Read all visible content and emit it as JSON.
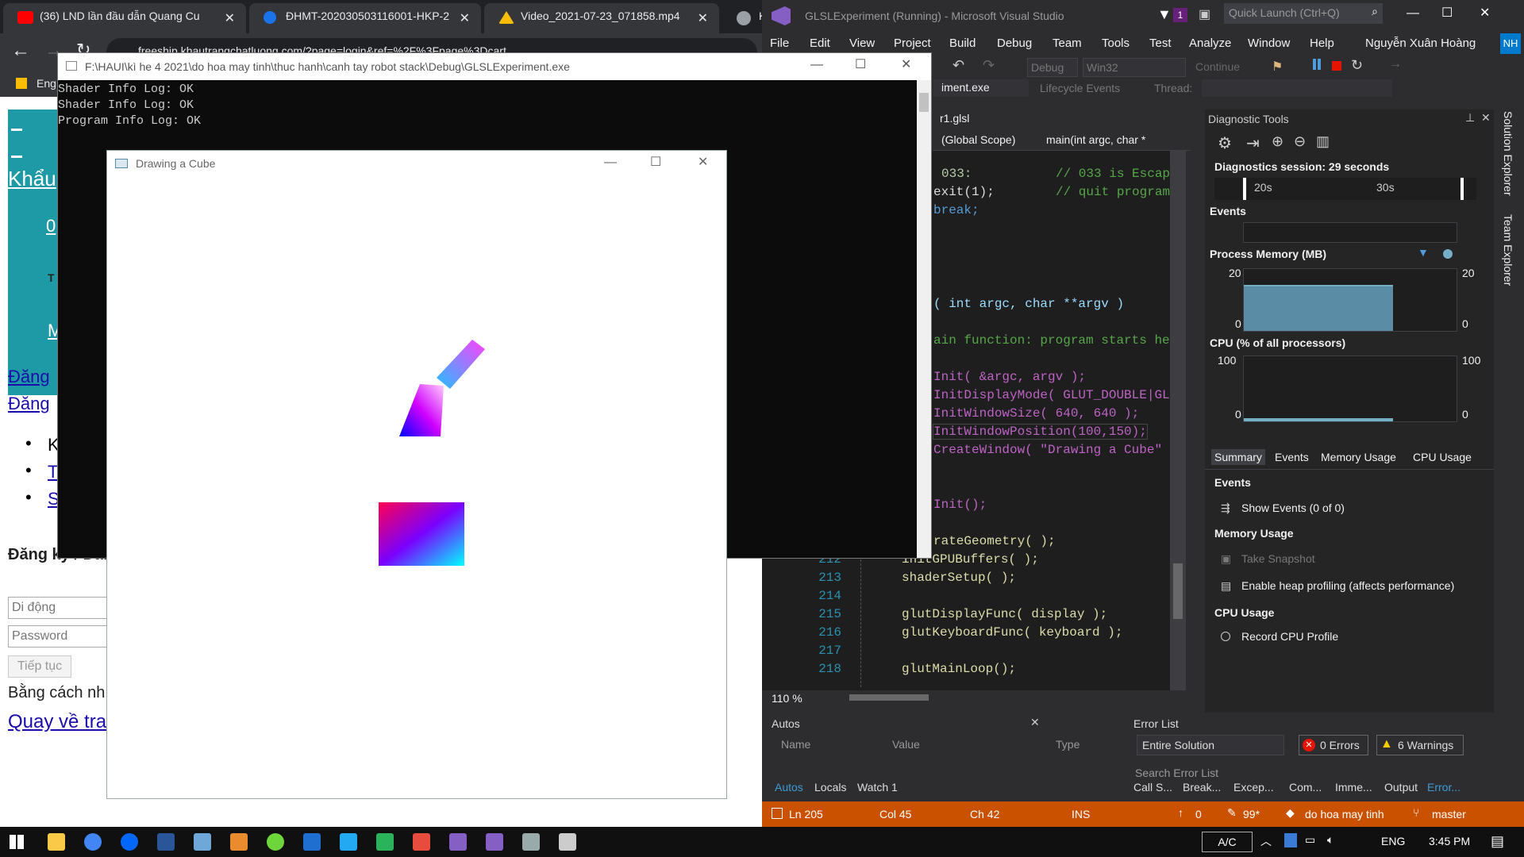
{
  "browser": {
    "tabs": [
      {
        "label": "(36) LND lần đầu dẫn Quang Cu",
        "icon": "youtube-icon",
        "color": "#ff0000"
      },
      {
        "label": "ĐHMT-20203050311600​1-HKP-2",
        "icon": "classroom-icon",
        "color": "#1a73e8"
      },
      {
        "label": "Video_2021-07-23_071858.mp4",
        "icon": "drive-icon",
        "color": "#fbbc04"
      },
      {
        "label": "K",
        "icon": "globe-icon",
        "color": "#9aa0a6"
      }
    ],
    "url": "freeship.khautrangchatluong.com/?page=login&ref=%2F%3Fpage%3Dcart",
    "bookmark": "Eng"
  },
  "webpage": {
    "heading_partial": "Khẩu",
    "list_link_1": "0",
    "small_t": "T",
    "link_m": "M",
    "link_dang1": "Đăng",
    "link_dang2": "Đăng",
    "bullets": [
      "K",
      "T",
      "S"
    ],
    "section_title": "Đăng ký / Đăng",
    "phone_placeholder": "Di động",
    "password_placeholder": "Password",
    "continue_button": "Tiếp tục",
    "bang_cach": "Bằng cách nh",
    "quay_ve": "Quay về tra"
  },
  "console": {
    "title": "F:\\HAUI\\kì he 4 2021\\do hoa may tinh\\thuc hanh\\canh tay robot stack\\Debug\\GLSLExperiment.exe",
    "lines": [
      "Shader Info Log: OK",
      "Shader Info Log: OK",
      "Program Info Log: OK"
    ]
  },
  "cube_window": {
    "title": "Drawing a Cube"
  },
  "vs": {
    "title": "GLSLExperiment (Running) - Microsoft Visual Studio",
    "notification_count": "1",
    "quick_launch": "Quick Launch (Ctrl+Q)",
    "menu": [
      "File",
      "Edit",
      "View",
      "Project",
      "Build",
      "Debug",
      "Team",
      "Tools",
      "Test",
      "Analyze",
      "Window",
      "Help"
    ],
    "user": "Nguyễn Xuân Hoàng",
    "user_initials": "NH",
    "toolbar": {
      "config": "Debug",
      "platform": "Win32",
      "continue": "Continue",
      "process": "iment.exe",
      "lifecycle": "Lifecycle Events",
      "thread": "Thread:"
    },
    "file_tab": "r1.glsl",
    "scope": "(Global Scope)",
    "function": "main(int argc, char *",
    "zoom": "110 %",
    "line_numbers": [
      "212",
      "213",
      "214",
      "215",
      "216",
      "217",
      "218"
    ],
    "code": {
      "l1a": "033:",
      "l1b": "// 033 is Escape",
      "l2a": "exit(1);",
      "l2b": "// quit program",
      "l3": "break;",
      "l4": "( int argc, char **argv )",
      "l5": "ain function: program starts her",
      "l6": "Init( &argc, argv );",
      "l7": "InitDisplayMode( GLUT_DOUBLE|GLU",
      "l8": "InitWindowSize( 640, 640 );",
      "l9": "InitWindowPosition(100,150);",
      "l10": "CreateWindow( \"Drawing a Cube\" )",
      "l11": "Init();",
      "l12": "rateGeometry( );",
      "l13": "initGPUBuffers( );",
      "l14": "shaderSetup( );",
      "l15": "glutDisplayFunc( display );",
      "l16": "glutKeyboardFunc( keyboard );",
      "l17": "glutMainLoop();"
    },
    "diagnostic": {
      "title": "Diagnostic Tools",
      "session": "Diagnostics session: 29 seconds",
      "tick1": "20s",
      "tick2": "30s",
      "events": "Events",
      "memory_label": "Process Memory (MB)",
      "mem_max": "20",
      "mem_min": "0",
      "cpu_label": "CPU (% of all processors)",
      "cpu_max": "100",
      "cpu_min": "0",
      "tabs": [
        "Summary",
        "Events",
        "Memory Usage",
        "CPU Usage"
      ],
      "sec_events": "Events",
      "show_events": "Show Events (0 of 0)",
      "sec_memory": "Memory Usage",
      "take_snapshot": "Take Snapshot",
      "heap_profiling": "Enable heap profiling (affects performance)",
      "sec_cpu": "CPU Usage",
      "record_cpu": "Record CPU Profile"
    },
    "side_tabs": [
      "Solution Explorer",
      "Team Explorer"
    ],
    "autos": {
      "title": "Autos",
      "cols": [
        "Name",
        "Value",
        "Type"
      ],
      "tabs": [
        "Autos",
        "Locals",
        "Watch 1"
      ]
    },
    "errors": {
      "title": "Error List",
      "scope": "Entire Solution",
      "errors": "0 Errors",
      "warnings": "6 Warnings",
      "search": "Search Error List",
      "tabs": [
        "Call S...",
        "Break...",
        "Excep...",
        "Com...",
        "Imme...",
        "Output",
        "Error..."
      ]
    },
    "status": {
      "ln": "Ln 205",
      "col": "Col 45",
      "ch": "Ch 42",
      "mode": "INS",
      "up": "0",
      "pen": "99*",
      "repo": "do hoa may tinh",
      "branch": "master"
    }
  },
  "taskbar": {
    "input": "A/C",
    "lang": "ENG",
    "time": "3:45 PM"
  }
}
